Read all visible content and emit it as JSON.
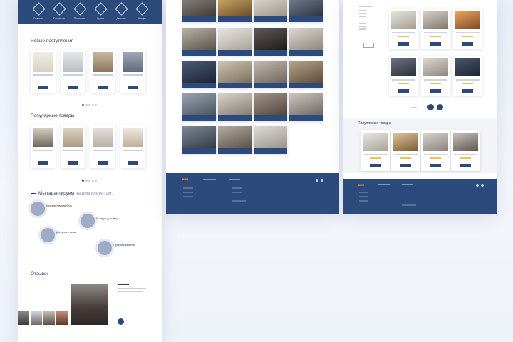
{
  "left_panel": {
    "categories": [
      {
        "label": "Спальни",
        "icon": "furniture-icon"
      },
      {
        "label": "Гостиные",
        "icon": "furniture-icon"
      },
      {
        "label": "Прихожие",
        "icon": "furniture-icon"
      },
      {
        "label": "Кухни",
        "icon": "furniture-icon"
      },
      {
        "label": "Детские",
        "icon": "furniture-icon"
      },
      {
        "label": "Шкафы",
        "icon": "furniture-icon"
      }
    ],
    "new_title": "Новые поступления",
    "popular_title": "Популярные товары",
    "guarantee_title_prefix": "Мы гарантируем",
    "guarantee_title_rest": "нашим клиентам:",
    "features": [
      "Качественную мебель",
      "Быструю доставку",
      "Доступные цены",
      "Гарантию качества"
    ],
    "reviews_title": "Отзывы"
  },
  "middle_panel": {
    "grid_captions": [
      "",
      "",
      "",
      "",
      "",
      "",
      "",
      "",
      "",
      "",
      "",
      "",
      "",
      "",
      "",
      "",
      "",
      "",
      "",
      "",
      "",
      "",
      "",
      "",
      "",
      ""
    ]
  },
  "right_panel": {
    "popular_title": "Популярные товары"
  },
  "colors": {
    "brand_navy": "#2d4a7c",
    "accent_orange": "#f08a2c",
    "rating_yellow": "#e8c44a"
  }
}
